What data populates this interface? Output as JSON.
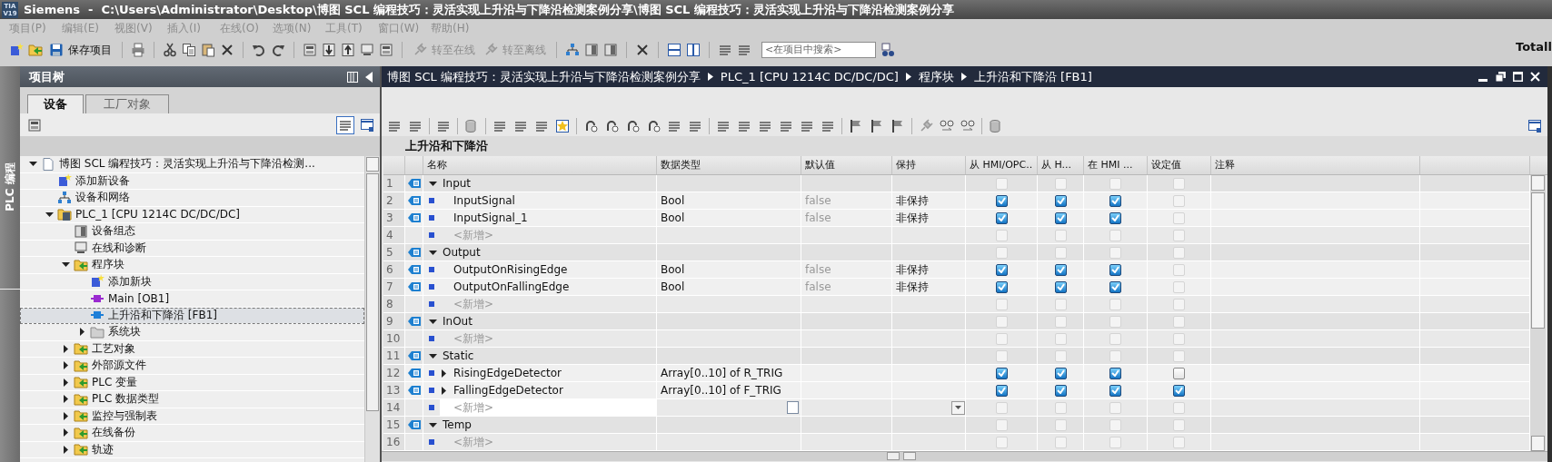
{
  "title_bar": {
    "logo": [
      "TIA",
      "V19"
    ],
    "title": "Siemens  -  C:\\Users\\Administrator\\Desktop\\博图 SCL 编程技巧：灵活实现上升沿与下降沿检测案例分享\\博图 SCL 编程技巧：灵活实现上升沿与下降沿检测案例分享"
  },
  "menu": [
    "项目(P)",
    "编辑(E)",
    "视图(V)",
    "插入(I)",
    "在线(O)",
    "选项(N)",
    "工具(T)",
    "窗口(W)",
    "帮助(H)"
  ],
  "toolbar": {
    "save": {
      "label": "保存项目"
    },
    "go_online": {
      "label": "转至在线",
      "disabled": true
    },
    "go_offline": {
      "label": "转至离线",
      "disabled": true
    },
    "search": {
      "placeholder": "<在项目中搜索>"
    },
    "brand": "Totall"
  },
  "side_strip": {
    "label": "PLC 编程"
  },
  "project_tree": {
    "title": "项目树",
    "tabs": [
      {
        "label": "设备",
        "selected": true
      },
      {
        "label": "工厂对象",
        "selected": false
      }
    ],
    "items": [
      {
        "label": "博图 SCL 编程技巧：灵活实现上升沿与下降沿检测...",
        "kind": "project",
        "expanded": true,
        "selected": false,
        "children": [
          {
            "label": "添加新设备",
            "kind": "add",
            "selected": false
          },
          {
            "label": "设备和网络",
            "kind": "network",
            "selected": false
          },
          {
            "label": "PLC_1 [CPU 1214C DC/DC/DC]",
            "kind": "device",
            "expanded": true,
            "selected": false,
            "children": [
              {
                "label": "设备组态",
                "kind": "config",
                "selected": false
              },
              {
                "label": "在线和诊断",
                "kind": "diagnostics",
                "selected": false
              },
              {
                "label": "程序块",
                "kind": "folder",
                "expanded": true,
                "selected": false,
                "children": [
                  {
                    "label": "添加新块",
                    "kind": "add",
                    "selected": false
                  },
                  {
                    "label": "Main [OB1]",
                    "kind": "ob",
                    "selected": false
                  },
                  {
                    "label": "上升沿和下降沿 [FB1]",
                    "kind": "fb",
                    "selected": true
                  },
                  {
                    "label": "系统块",
                    "kind": "sysfolder",
                    "expanded": false,
                    "selected": false
                  }
                ]
              },
              {
                "label": "工艺对象",
                "kind": "folder",
                "expanded": false,
                "selected": false
              },
              {
                "label": "外部源文件",
                "kind": "folder",
                "expanded": false,
                "selected": false
              },
              {
                "label": "PLC 变量",
                "kind": "folder",
                "expanded": false,
                "selected": false
              },
              {
                "label": "PLC 数据类型",
                "kind": "folder",
                "expanded": false,
                "selected": false
              },
              {
                "label": "监控与强制表",
                "kind": "folder",
                "expanded": false,
                "selected": false
              },
              {
                "label": "在线备份",
                "kind": "folder",
                "expanded": false,
                "selected": false
              },
              {
                "label": "轨迹",
                "kind": "folder",
                "expanded": false,
                "selected": false
              }
            ]
          }
        ]
      }
    ]
  },
  "editor": {
    "breadcrumb": [
      "博图 SCL 编程技巧：灵活实现上升沿与下降沿检测案例分享",
      "PLC_1 [CPU 1214C DC/DC/DC]",
      "程序块",
      "上升沿和下降沿 [FB1]"
    ],
    "block_title": "上升沿和下降沿",
    "columns": [
      "名称",
      "数据类型",
      "默认值",
      "保持",
      "从 HMI/OPC..",
      "从 H...",
      "在 HMI ...",
      "设定值",
      "注释"
    ],
    "rows": [
      {
        "num": "1",
        "kind": "section",
        "name": "Input",
        "expanded": true,
        "checks": [
          {
            "checked": false,
            "disabled": true
          },
          {
            "checked": false,
            "disabled": true
          },
          {
            "checked": false,
            "disabled": true
          },
          {
            "checked": false,
            "disabled": true
          }
        ]
      },
      {
        "num": "2",
        "kind": "var",
        "name": "InputSignal",
        "type": "Bool",
        "default": "false",
        "retain": "非保持",
        "checks": [
          {
            "checked": true,
            "disabled": false
          },
          {
            "checked": true,
            "disabled": false
          },
          {
            "checked": true,
            "disabled": false
          },
          {
            "checked": false,
            "disabled": true
          }
        ]
      },
      {
        "num": "3",
        "kind": "var",
        "name": "InputSignal_1",
        "type": "Bool",
        "default": "false",
        "retain": "非保持",
        "checks": [
          {
            "checked": true,
            "disabled": false
          },
          {
            "checked": true,
            "disabled": false
          },
          {
            "checked": true,
            "disabled": false
          },
          {
            "checked": false,
            "disabled": true
          }
        ]
      },
      {
        "num": "4",
        "kind": "add",
        "name": "<新增>",
        "editing": false,
        "checks": [
          {
            "checked": false,
            "disabled": true
          },
          {
            "checked": false,
            "disabled": true
          },
          {
            "checked": false,
            "disabled": true
          },
          {
            "checked": false,
            "disabled": true
          }
        ]
      },
      {
        "num": "5",
        "kind": "section",
        "name": "Output",
        "expanded": true,
        "checks": [
          {
            "checked": false,
            "disabled": true
          },
          {
            "checked": false,
            "disabled": true
          },
          {
            "checked": false,
            "disabled": true
          },
          {
            "checked": false,
            "disabled": true
          }
        ]
      },
      {
        "num": "6",
        "kind": "var",
        "name": "OutputOnRisingEdge",
        "type": "Bool",
        "default": "false",
        "retain": "非保持",
        "checks": [
          {
            "checked": true,
            "disabled": false
          },
          {
            "checked": true,
            "disabled": false
          },
          {
            "checked": true,
            "disabled": false
          },
          {
            "checked": false,
            "disabled": true
          }
        ]
      },
      {
        "num": "7",
        "kind": "var",
        "name": "OutputOnFallingEdge",
        "type": "Bool",
        "default": "false",
        "retain": "非保持",
        "checks": [
          {
            "checked": true,
            "disabled": false
          },
          {
            "checked": true,
            "disabled": false
          },
          {
            "checked": true,
            "disabled": false
          },
          {
            "checked": false,
            "disabled": true
          }
        ]
      },
      {
        "num": "8",
        "kind": "add",
        "name": "<新增>",
        "editing": false,
        "checks": [
          {
            "checked": false,
            "disabled": true
          },
          {
            "checked": false,
            "disabled": true
          },
          {
            "checked": false,
            "disabled": true
          },
          {
            "checked": false,
            "disabled": true
          }
        ]
      },
      {
        "num": "9",
        "kind": "section",
        "name": "InOut",
        "expanded": true,
        "checks": [
          {
            "checked": false,
            "disabled": true
          },
          {
            "checked": false,
            "disabled": true
          },
          {
            "checked": false,
            "disabled": true
          },
          {
            "checked": false,
            "disabled": true
          }
        ]
      },
      {
        "num": "10",
        "kind": "add",
        "name": "<新增>",
        "editing": false,
        "checks": [
          {
            "checked": false,
            "disabled": true
          },
          {
            "checked": false,
            "disabled": true
          },
          {
            "checked": false,
            "disabled": true
          },
          {
            "checked": false,
            "disabled": true
          }
        ]
      },
      {
        "num": "11",
        "kind": "section",
        "name": "Static",
        "expanded": true,
        "checks": [
          {
            "checked": false,
            "disabled": true
          },
          {
            "checked": false,
            "disabled": true
          },
          {
            "checked": false,
            "disabled": true
          },
          {
            "checked": false,
            "disabled": true
          }
        ]
      },
      {
        "num": "12",
        "kind": "var",
        "name": "RisingEdgeDetector",
        "expanded": false,
        "type": "Array[0..10] of R_TRIG",
        "checks": [
          {
            "checked": true,
            "disabled": false
          },
          {
            "checked": true,
            "disabled": false
          },
          {
            "checked": true,
            "disabled": false
          },
          {
            "checked": false,
            "disabled": false
          }
        ]
      },
      {
        "num": "13",
        "kind": "var",
        "name": "FallingEdgeDetector",
        "expanded": false,
        "type": "Array[0..10] of F_TRIG",
        "checks": [
          {
            "checked": true,
            "disabled": false
          },
          {
            "checked": true,
            "disabled": false
          },
          {
            "checked": true,
            "disabled": false
          },
          {
            "checked": true,
            "disabled": false
          }
        ]
      },
      {
        "num": "14",
        "kind": "add",
        "name": "<新增>",
        "editing": true,
        "checks": [
          {
            "checked": false,
            "disabled": true
          },
          {
            "checked": false,
            "disabled": true
          },
          {
            "checked": false,
            "disabled": true
          },
          {
            "checked": false,
            "disabled": true
          }
        ]
      },
      {
        "num": "15",
        "kind": "section",
        "name": "Temp",
        "expanded": true,
        "checks": [
          {
            "checked": false,
            "disabled": true
          },
          {
            "checked": false,
            "disabled": true
          },
          {
            "checked": false,
            "disabled": true
          },
          {
            "checked": false,
            "disabled": true
          }
        ]
      },
      {
        "num": "16",
        "kind": "add",
        "name": "<新增>",
        "editing": false,
        "checks": [
          {
            "checked": false,
            "disabled": true
          },
          {
            "checked": false,
            "disabled": true
          },
          {
            "checked": false,
            "disabled": true
          },
          {
            "checked": false,
            "disabled": true
          }
        ]
      }
    ]
  }
}
